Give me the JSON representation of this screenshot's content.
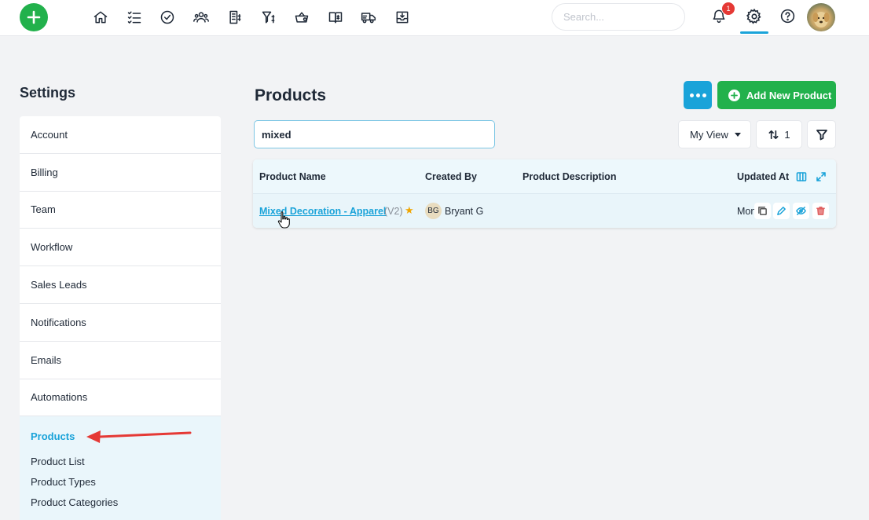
{
  "topbar": {
    "add_icon": "plus-icon",
    "nav_icons": [
      "home-icon",
      "task-list-icon",
      "check-circle-icon",
      "team-icon",
      "invoice-icon",
      "pricing-filter-icon",
      "basket-icon",
      "catalog-book-icon",
      "delivery-truck-icon",
      "inbox-icon"
    ],
    "search_placeholder": "Search...",
    "search_value": "",
    "notification_count": "1",
    "settings_icon": "gear-icon",
    "help_icon": "help-icon"
  },
  "sidebar": {
    "title": "Settings",
    "items": [
      {
        "label": "Account"
      },
      {
        "label": "Billing"
      },
      {
        "label": "Team"
      },
      {
        "label": "Workflow"
      },
      {
        "label": "Sales Leads"
      },
      {
        "label": "Notifications"
      },
      {
        "label": "Emails"
      },
      {
        "label": "Automations"
      }
    ],
    "active_section": {
      "label": "Products",
      "subitems": [
        "Product List",
        "Product Types",
        "Product Categories"
      ]
    }
  },
  "main": {
    "title": "Products",
    "more_button_icon": "ellipsis-icon",
    "add_button_label": "Add New Product",
    "search_value": "mixed",
    "view_label": "My View",
    "sort_count": "1"
  },
  "table": {
    "columns": [
      "Product Name",
      "Created By",
      "Product Description",
      "Updated At"
    ],
    "rows": [
      {
        "product_name": "Mixed Decoration - Apparel",
        "version": "(V2)",
        "starred": true,
        "creator_initials": "BG",
        "creator": "Bryant G",
        "description": "",
        "updated": "Mon"
      }
    ]
  },
  "colors": {
    "accent": "#1aa3d9",
    "success": "#22b14c",
    "danger": "#e53935",
    "annotation": "#e53935",
    "star": "#f0a500"
  }
}
